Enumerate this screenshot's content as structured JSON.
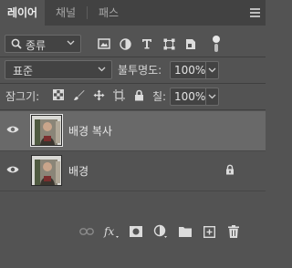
{
  "tabs": [
    {
      "label": "레이어",
      "active": true
    },
    {
      "label": "채널",
      "active": false
    },
    {
      "label": "패스",
      "active": false
    }
  ],
  "filter": {
    "kind_label": "종류",
    "icons": [
      "image-filter-icon",
      "adjustment-filter-icon",
      "type-filter-icon",
      "shape-filter-icon",
      "smart-object-filter-icon"
    ]
  },
  "blend": {
    "mode": "표준",
    "opacity_label": "불투명도:",
    "opacity_value": "100%"
  },
  "lock": {
    "label": "잠그기:",
    "icons": [
      "lock-transparent-pixels-icon",
      "lock-image-pixels-icon",
      "lock-position-icon",
      "lock-artboard-icon",
      "lock-all-icon"
    ],
    "fill_label": "칠:",
    "fill_value": "100%"
  },
  "layers": [
    {
      "name": "배경 복사",
      "selected": true,
      "locked": false
    },
    {
      "name": "배경",
      "selected": false,
      "locked": true
    }
  ],
  "footer_icons": [
    "link-layers-icon",
    "fx-icon",
    "add-mask-icon",
    "new-adjustment-layer-icon",
    "new-group-icon",
    "new-layer-icon",
    "delete-layer-icon"
  ],
  "colors": {
    "panel": "#535353",
    "tabbar": "#424242",
    "selected_row": "#696969"
  }
}
